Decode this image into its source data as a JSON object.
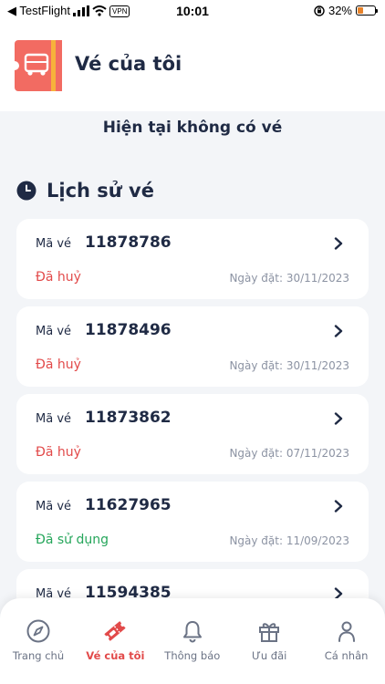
{
  "status_bar": {
    "back_app": "◀ TestFlight",
    "vpn": "VPN",
    "time": "10:01",
    "battery": "32%",
    "battery_level": 0.32
  },
  "header": {
    "title": "Vé của tôi",
    "logo_icon": "bus-ticket-icon"
  },
  "current": {
    "empty_text": "Hiện tại không có vé"
  },
  "history": {
    "title": "Lịch sử vé",
    "code_label": "Mã vé",
    "tickets": [
      {
        "code": "11878786",
        "status": "Đã huỷ",
        "status_type": "cancel",
        "date": "Ngày đặt: 30/11/2023"
      },
      {
        "code": "11878496",
        "status": "Đã huỷ",
        "status_type": "cancel",
        "date": "Ngày đặt: 30/11/2023"
      },
      {
        "code": "11873862",
        "status": "Đã huỷ",
        "status_type": "cancel",
        "date": "Ngày đặt: 07/11/2023"
      },
      {
        "code": "11627965",
        "status": "Đã sử dụng",
        "status_type": "used",
        "date": "Ngày đặt: 11/09/2023"
      },
      {
        "code": "11594385",
        "status": "",
        "status_type": "",
        "date": ""
      }
    ]
  },
  "colors": {
    "accent": "#e24a4a",
    "used": "#26a65b",
    "text": "#1f2a44",
    "muted": "#8c93a3"
  },
  "tabbar": {
    "tabs": [
      {
        "label": "Trang chủ",
        "icon": "compass-icon",
        "active": false
      },
      {
        "label": "Vé của tôi",
        "icon": "ticket-icon",
        "active": true
      },
      {
        "label": "Thông báo",
        "icon": "bell-icon",
        "active": false
      },
      {
        "label": "Ưu đãi",
        "icon": "gift-icon",
        "active": false
      },
      {
        "label": "Cá nhân",
        "icon": "person-icon",
        "active": false
      }
    ]
  }
}
